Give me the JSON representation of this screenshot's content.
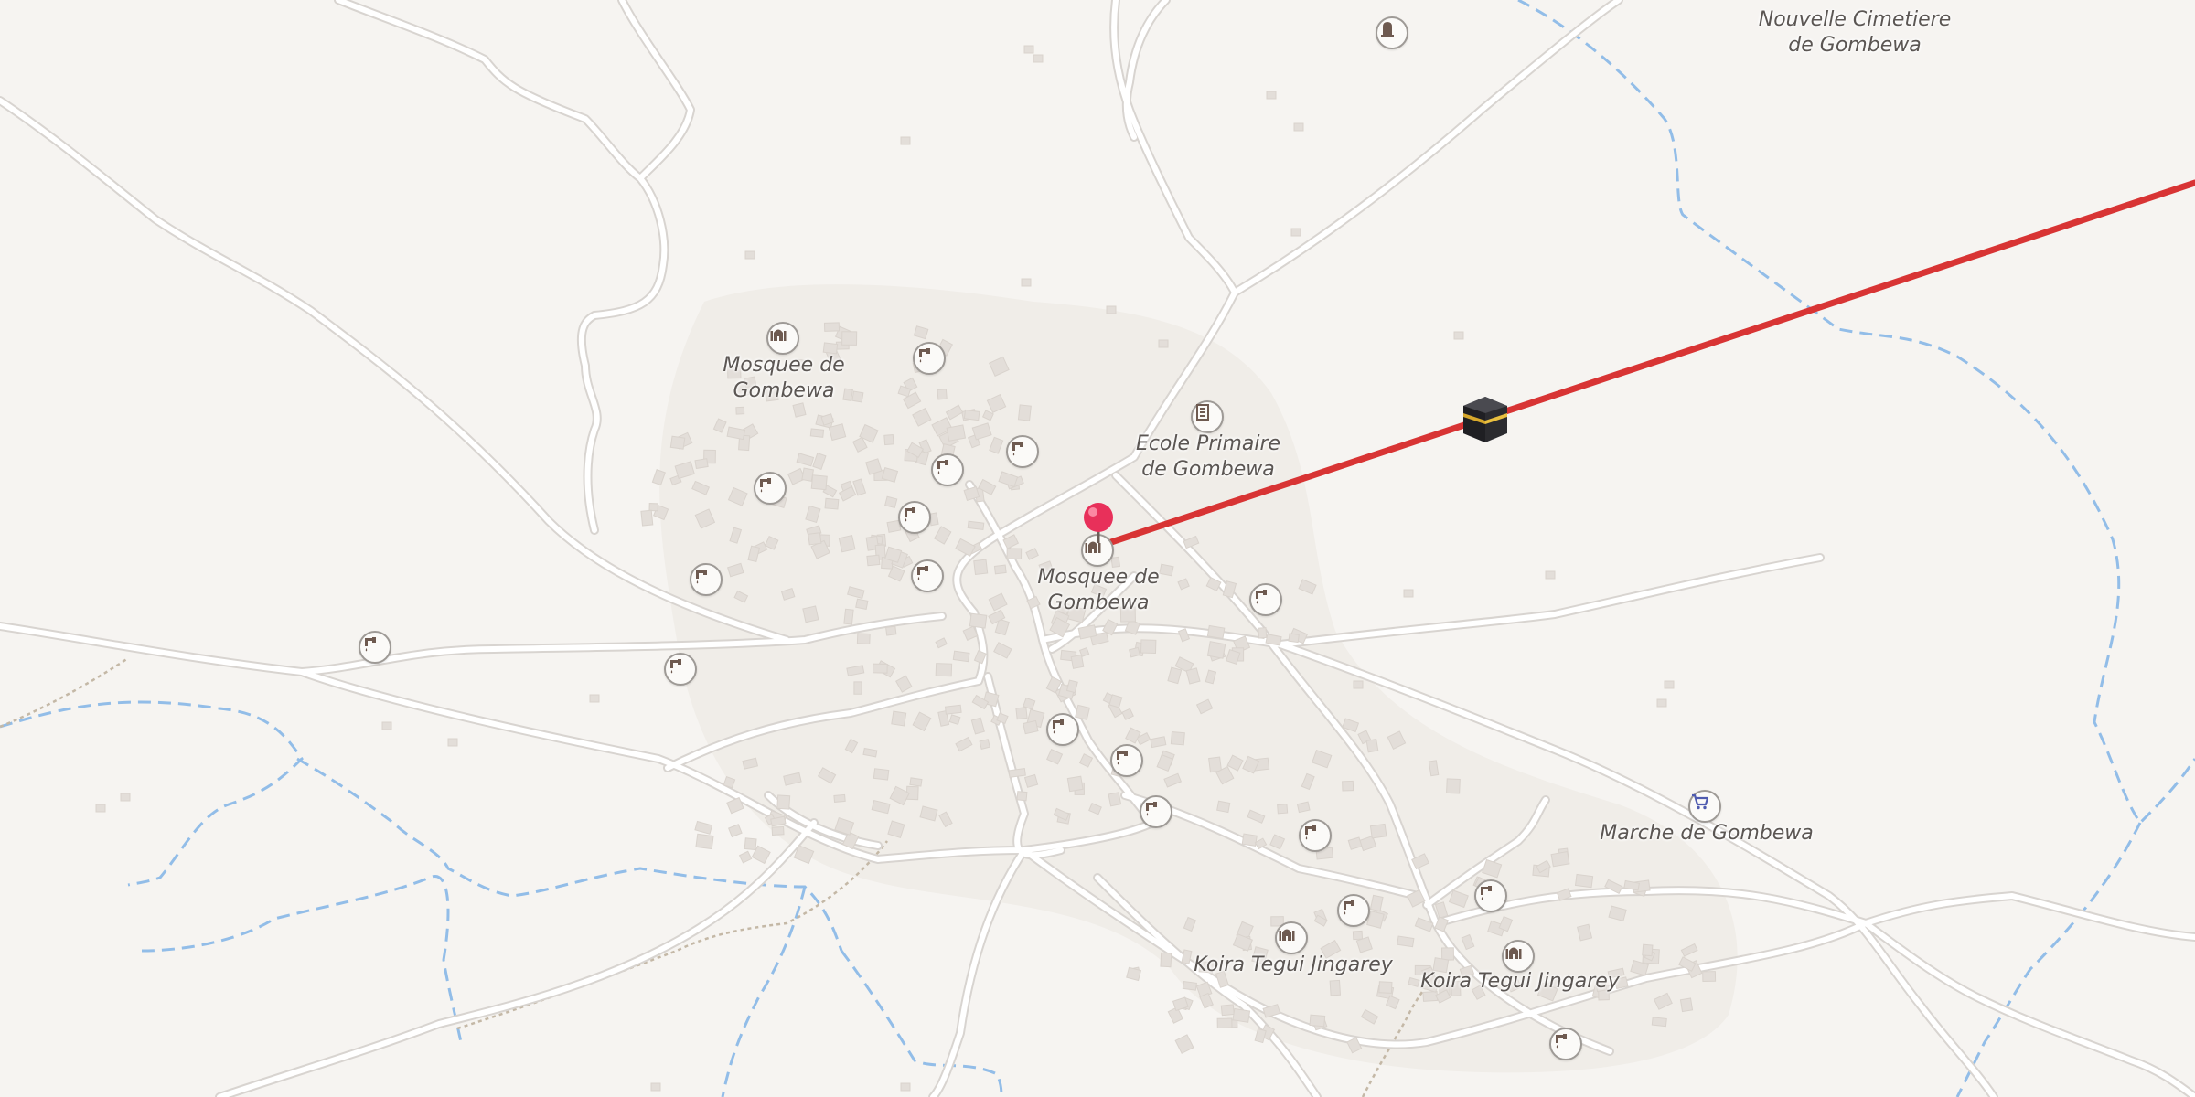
{
  "map": {
    "colors": {
      "background": "#f6f4f1",
      "settlement": "#efebe6",
      "road": "#ffffff",
      "road_casing": "#d8d4d0",
      "building": "#e3ded9",
      "stream": "#92bde8",
      "track": "#c4b8a6",
      "qibla_line": "#d83434",
      "pin": "#e8305a",
      "poi_icon": "#6e5a50",
      "marketplace_icon": "#4f5bb0"
    },
    "labels": {
      "cemetery": {
        "line1": "Nouvelle Cimetiere",
        "line2": "de Gombewa"
      },
      "mosque_north": {
        "line1": "Mosquee de",
        "line2": "Gombewa"
      },
      "school": {
        "line1": "Ecole Primaire",
        "line2": "de Gombewa"
      },
      "mosque_center": {
        "line1": "Mosquee de",
        "line2": "Gombewa"
      },
      "market": {
        "line1": "Marche de Gombewa"
      },
      "koira_1": {
        "line1": "Koira Tegui Jingarey"
      },
      "koira_2": {
        "line1": "Koira Tegui Jingarey"
      }
    },
    "icons": {
      "water_tap": "water-tap-icon",
      "mosque": "mosque-icon",
      "school": "school-icon",
      "cemetery": "cemetery-icon",
      "market": "shopping-cart-icon",
      "kaaba": "kaaba-icon",
      "pin": "location-pin-icon"
    }
  }
}
